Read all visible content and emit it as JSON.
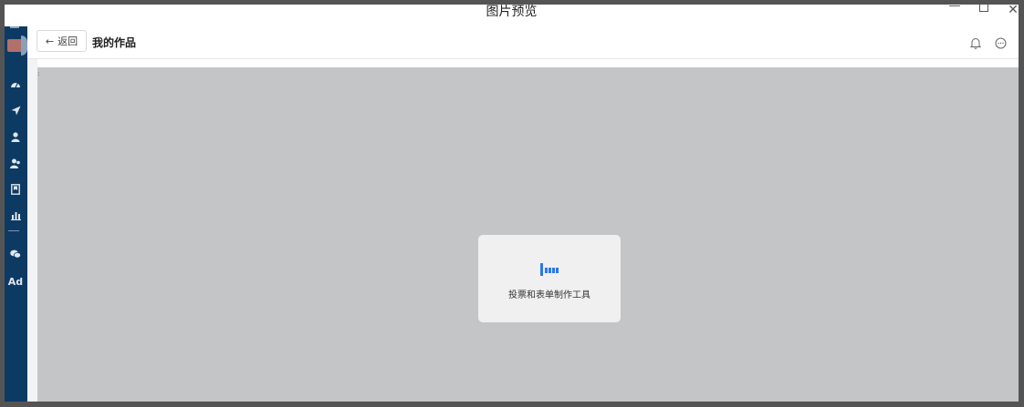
{
  "window": {
    "title": "图片预览"
  },
  "sidebar": {
    "items": [
      {
        "icon": "dashboard-icon"
      },
      {
        "icon": "send-icon"
      },
      {
        "icon": "user-icon"
      },
      {
        "icon": "users-icon"
      },
      {
        "icon": "bookmark-icon"
      },
      {
        "icon": "bar-chart-icon"
      },
      {
        "icon": "wechat-icon"
      },
      {
        "icon": "ad-icon",
        "label": "Ad"
      }
    ]
  },
  "header": {
    "back_label": "返回",
    "title": "我的作品"
  },
  "loading": {
    "text": "投票和表单制作工具"
  },
  "colors": {
    "sidebar_bg": "#0d3a63",
    "content_bg": "#c4c5c7",
    "accent": "#2e78e6"
  }
}
